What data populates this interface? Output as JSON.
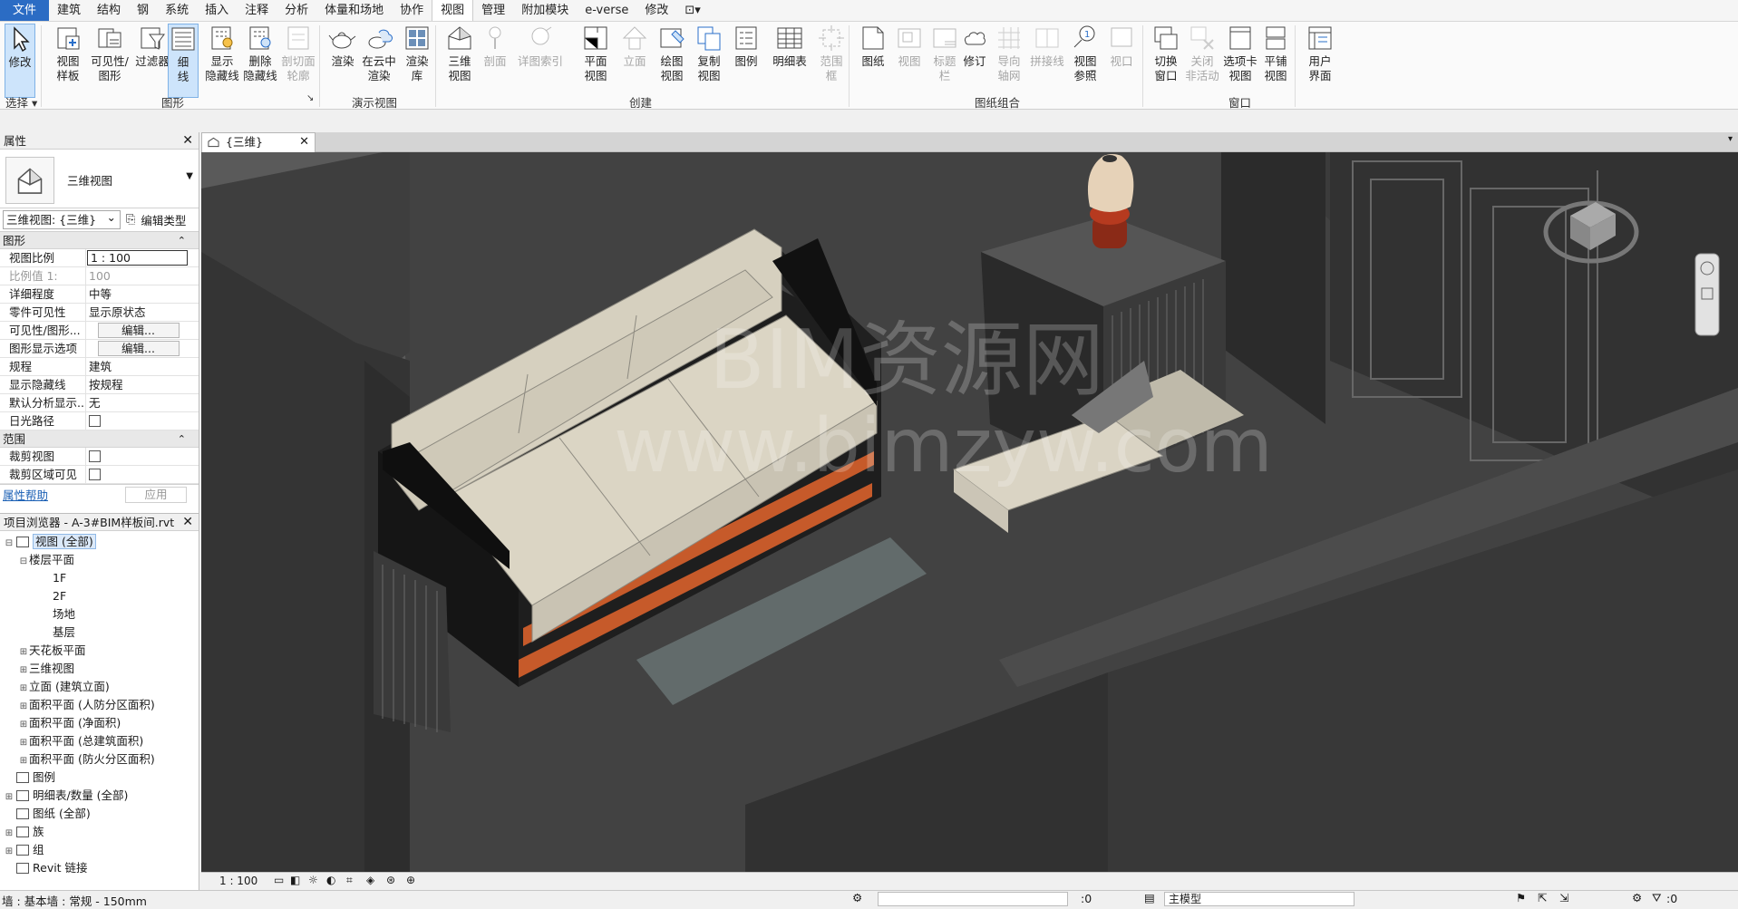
{
  "menu": {
    "items": [
      "文件",
      "建筑",
      "结构",
      "钢",
      "系统",
      "插入",
      "注释",
      "分析",
      "体量和场地",
      "协作",
      "视图",
      "管理",
      "附加模块",
      "e-verse",
      "修改",
      "⊡▾"
    ],
    "active": "视图"
  },
  "ribbon": {
    "buttons": {
      "modify": "修改",
      "view_template": "视图\n样板",
      "visibility": "可见性/\n图形",
      "filter": "过滤器",
      "thin_lines": "细\n线",
      "show_hidden": "显示\n隐藏线",
      "remove_hidden": "删除\n隐藏线",
      "cut_profile": "剖切面\n轮廓",
      "render": "渲染",
      "cloud_render": "在云中\n渲染",
      "render_gallery": "渲染\n库",
      "3d_view": "三维\n视图",
      "section": "剖面",
      "detail_index": "详图索引",
      "plan_view": "平面\n视图",
      "elevation": "立面",
      "drafting_view": "绘图\n视图",
      "duplicate_view": "复制\n视图",
      "legend": "图例",
      "schedule": "明细表",
      "scope_box": "范围\n框",
      "sheet": "图纸",
      "view": "视图",
      "title_block": "标题\n栏",
      "revision": "修订",
      "guide_grid": "导向\n轴网",
      "matchline": "拼接线",
      "view_reference": "视图\n参照",
      "viewports": "视口",
      "switch_windows": "切换\n窗口",
      "close_inactive": "关闭\n非活动",
      "tab_views": "选项卡\n视图",
      "tile_views": "平铺\n视图",
      "user_interface": "用户\n界面"
    },
    "groups": {
      "select": "选择 ▾",
      "graphics": "图形",
      "presentation": "演示视图",
      "create": "创建",
      "sheet_composition": "图纸组合",
      "windows": "窗口"
    }
  },
  "properties": {
    "title": "属性",
    "type_name": "三维视图",
    "instance_selector": "三维视图: {三维}",
    "edit_type": "编辑类型",
    "sections": {
      "graphics": "图形",
      "extents": "范围"
    },
    "rows": [
      {
        "k": "视图比例",
        "v": "1 : 100"
      },
      {
        "k": "比例值 1:",
        "v": "100"
      },
      {
        "k": "详细程度",
        "v": "中等"
      },
      {
        "k": "零件可见性",
        "v": "显示原状态"
      },
      {
        "k": "可见性/图形...",
        "v": "编辑..."
      },
      {
        "k": "图形显示选项",
        "v": "编辑..."
      },
      {
        "k": "规程",
        "v": "建筑"
      },
      {
        "k": "显示隐藏线",
        "v": "按规程"
      },
      {
        "k": "默认分析显示...",
        "v": "无"
      },
      {
        "k": "日光路径",
        "v": ""
      }
    ],
    "extent_rows": [
      {
        "k": "裁剪视图",
        "v": ""
      },
      {
        "k": "裁剪区域可见",
        "v": ""
      }
    ],
    "help": "属性帮助",
    "apply": "应用"
  },
  "browser": {
    "title": "项目浏览器 - A-3#BIM样板间.rvt",
    "nodes": [
      {
        "label": "视图 (全部)",
        "exp": "⊟"
      },
      {
        "label": "楼层平面",
        "exp": "⊟"
      },
      {
        "label": "1F",
        "exp": ""
      },
      {
        "label": "2F",
        "exp": ""
      },
      {
        "label": "场地",
        "exp": ""
      },
      {
        "label": "基层",
        "exp": ""
      },
      {
        "label": "天花板平面",
        "exp": "⊞"
      },
      {
        "label": "三维视图",
        "exp": "⊞"
      },
      {
        "label": "立面 (建筑立面)",
        "exp": "⊞"
      },
      {
        "label": "面积平面 (人防分区面积)",
        "exp": "⊞"
      },
      {
        "label": "面积平面 (净面积)",
        "exp": "⊞"
      },
      {
        "label": "面积平面 (总建筑面积)",
        "exp": "⊞"
      },
      {
        "label": "面积平面 (防火分区面积)",
        "exp": "⊞"
      },
      {
        "label": "图例",
        "exp": ""
      },
      {
        "label": "明细表/数量 (全部)",
        "exp": "⊞"
      },
      {
        "label": "图纸 (全部)",
        "exp": ""
      },
      {
        "label": "族",
        "exp": "⊞"
      },
      {
        "label": "组",
        "exp": "⊞"
      },
      {
        "label": "Revit 链接",
        "exp": ""
      }
    ]
  },
  "view": {
    "tab_label": "{三维}",
    "watermark_line1": "BIM资源网",
    "watermark_line2": "www.bimzyw.com"
  },
  "viewbar": {
    "scale": "1 : 100"
  },
  "statusbar": {
    "text": "墙 : 基本墙 : 常规 - 150mm",
    "selection_count": ":0",
    "model_label": "主模型",
    "filter_count": ":0"
  },
  "colors": {
    "accent": "#2b6cc4",
    "canvas_bg": "#3c3c3c",
    "sofa_cushion": "#d8d3c4",
    "sofa_frame": "#1f1f1f",
    "lamp_base": "#8a2a17",
    "trim": "#c65a2a"
  }
}
